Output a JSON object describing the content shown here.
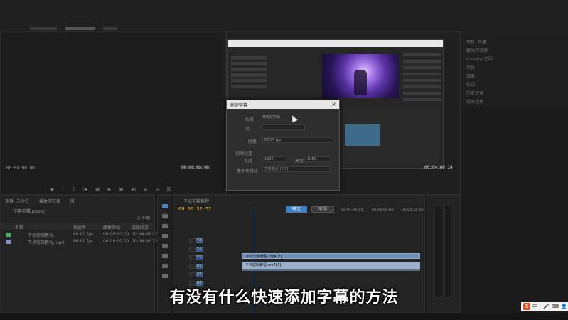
{
  "source_monitor": {
    "timecode_left": "00:00:00:00",
    "timecode_right": "00:00:00:00",
    "controls": [
      "◆",
      "{",
      "}",
      "|◀",
      "◀|",
      "▶",
      "|▶",
      "▶|",
      "⊞",
      "⊟",
      "⌧"
    ]
  },
  "right_panel": {
    "items": [
      "项目: 新建",
      "媒体浏览器",
      "Lumetri 范围",
      "信息",
      "效果",
      "标记",
      "历史记录",
      "效果控件"
    ]
  },
  "program_monitor": {
    "timecode_left": "00:00:00:00",
    "timecode_right": "00:04:06:24"
  },
  "dialog": {
    "title": "新建字幕",
    "close": "×",
    "standard_label": "标准",
    "standard_value": "开放式字幕",
    "stream_label": "流",
    "timebase_label": "时基",
    "timebase_value": "60.00 fps",
    "video_settings_label": "视频设置",
    "width_label": "宽度",
    "width_value": "1920",
    "height_label": "高度",
    "height_value": "1080",
    "pixel_aspect_label": "像素长宽比",
    "pixel_aspect_value": "方形像素 (1.0)",
    "ok_button": "确定",
    "cancel_button": "取消"
  },
  "project_panel": {
    "tabs": [
      "项目: 未命名",
      "媒体浏览器",
      "库"
    ],
    "project_name": "字幕剪辑.prproj",
    "item_count": "2 个项",
    "columns": [
      "名称",
      "帧速率",
      "媒体开始",
      "媒体结束"
    ],
    "rows": [
      {
        "name": "不点剪辑教程",
        "fps": "60.00 fps",
        "start": "00:00:00:00",
        "end": "00:04:06:22",
        "color": "#3fb55a"
      },
      {
        "name": "不点剪辑教程.mp4",
        "fps": "60.00 fps",
        "start": "00:00:00:00",
        "end": "00:04:06:22",
        "color": "#7d8fd0"
      }
    ]
  },
  "timeline": {
    "sequence_tab": "不点剪辑教程",
    "timecode": "00:00:32:52",
    "ruler": [
      "00:01:45:00",
      "00:02:00:00",
      "00:02:15:00"
    ],
    "tracks": [
      "V3",
      "V2",
      "V1",
      "A1",
      "A2",
      "A3"
    ],
    "video_clip_label": "不点剪辑教程.mp4[V]",
    "audio_clip_label": "不点剪辑教程.mp4[A]"
  },
  "subtitle": "有没有什么快速添加字幕的方法",
  "tray": {
    "logo": "S",
    "items": [
      "中",
      "·",
      "🎤",
      "⌨",
      "👤"
    ]
  }
}
